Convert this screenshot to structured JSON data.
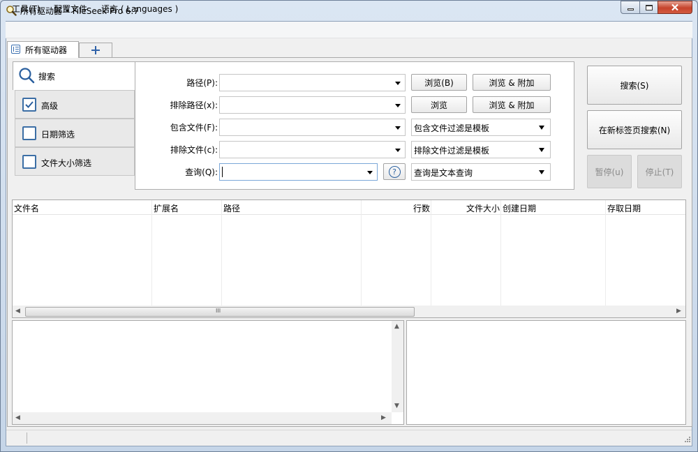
{
  "window": {
    "title": "所有驱动器 • FileSeek Pro 6.7"
  },
  "menu": {
    "tools": "工具(T)",
    "profile": "配置文件",
    "language": "语言 ( Languages )"
  },
  "tabs": {
    "active_label": "所有驱动器",
    "add_label": "+"
  },
  "nav": {
    "search": "搜索",
    "items": [
      {
        "label": "高级",
        "checked": true
      },
      {
        "label": "日期筛选",
        "checked": false
      },
      {
        "label": "文件大小筛选",
        "checked": false
      }
    ]
  },
  "form": {
    "path_label": "路径(P):",
    "exclude_path_label": "排除路径(x):",
    "include_files_label": "包含文件(F):",
    "exclude_files_label": "排除文件(c):",
    "query_label": "查询(Q):",
    "path_value": "",
    "exclude_path_value": "",
    "include_files_value": "",
    "exclude_files_value": "",
    "query_value": "",
    "browse_b": "浏览(B)",
    "browse_append_1": "浏览 & 附加",
    "browse": "浏览",
    "browse_append_2": "浏览 & 附加",
    "include_mode": "包含文件过滤是模板",
    "exclude_mode": "排除文件过滤是模板",
    "query_mode": "查询是文本查询",
    "help_glyph": "?"
  },
  "actions": {
    "search": "搜索(S)",
    "search_new_tab": "在新标签页搜索(N)",
    "pause": "暂停(u)",
    "stop": "停止(T)"
  },
  "results": {
    "columns": [
      "文件名",
      "扩展名",
      "路径",
      "行数",
      "文件大小",
      "创建日期",
      "存取日期"
    ],
    "rows": []
  },
  "scrollbar": {
    "grip": "III"
  },
  "colors": {
    "accent": "#3b6ea5",
    "close_button": "#c6442c",
    "disabled_text": "#8a8a8a"
  },
  "icons": [
    "magnifier-app-icon",
    "search-icon",
    "check-icon",
    "help-icon",
    "plus-icon",
    "drive-tab-icon"
  ]
}
